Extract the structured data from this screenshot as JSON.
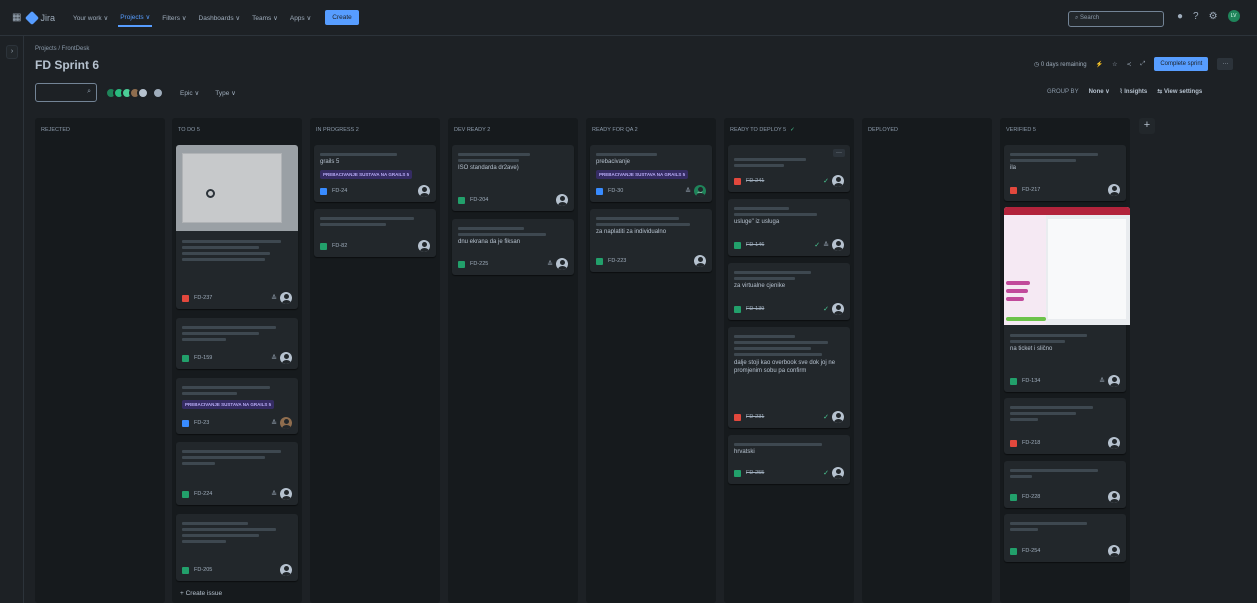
{
  "topnav": {
    "product": "Jira",
    "items": [
      "Your work ∨",
      "Projects ∨",
      "Filters ∨",
      "Dashboards ∨",
      "Teams ∨",
      "Apps ∨"
    ],
    "create": "Create",
    "search_placeholder": "Search",
    "avatar_initials": "LV"
  },
  "header": {
    "breadcrumb": "Projects / FrontDesk",
    "title": "FD Sprint 6",
    "days_remaining": "0 days remaining",
    "complete_sprint": "Complete sprint",
    "more": "···"
  },
  "filters": {
    "epic": "Epic ∨",
    "type": "Type ∨",
    "group_by_label": "GROUP BY",
    "group_by_value": "None ∨",
    "insights": "Insights",
    "view_settings": "View settings"
  },
  "columns": [
    {
      "title": "REJECTED"
    },
    {
      "title": "TO DO 5"
    },
    {
      "title": "IN PROGRESS 2"
    },
    {
      "title": "DEV READY 2"
    },
    {
      "title": "READY FOR QA 2"
    },
    {
      "title": "READY TO DEPLOY 5"
    },
    {
      "title": "DEPLOYED"
    },
    {
      "title": "VERIFIED 5"
    }
  ],
  "cards": {
    "todo": [
      {
        "key": "FD-237"
      },
      {
        "key": "FD-159"
      },
      {
        "key": "FD-23",
        "epic": "PREBACIVANJE SUSTAVA NA GRAILS 5"
      },
      {
        "key": "FD-224"
      },
      {
        "key": "FD-205"
      }
    ],
    "inprogress": [
      {
        "key": "FD-24",
        "text": "grails 5",
        "epic": "PREBACIVANJE SUSTAVA NA GRAILS 5"
      },
      {
        "key": "FD-82"
      }
    ],
    "devready": [
      {
        "key": "FD-204",
        "text": "ISO standarda dr2ave)"
      },
      {
        "key": "FD-225",
        "text": "dnu ekrana da je fiksan"
      }
    ],
    "qa": [
      {
        "key": "FD-30",
        "text": "prebacivanje",
        "epic": "PREBACIVANJE SUSTAVA NA GRAILS 5",
        "assignee": "JD"
      },
      {
        "key": "FD-223",
        "text": "za naplatiti za individualno"
      }
    ],
    "deploy": [
      {
        "key": "FD-241"
      },
      {
        "key": "FD-146",
        "text": "usluge\" iz usluga"
      },
      {
        "key": "FD-139",
        "text": "za virtualne cjenike"
      },
      {
        "key": "FD-231",
        "text": "dalje stoji kao overbook sve dok joj ne promjenim sobu pa confirm"
      },
      {
        "key": "FD-255",
        "text": "hrvatski"
      }
    ],
    "verified": [
      {
        "key": "FD-217",
        "text": "ila"
      },
      {
        "key": "FD-134",
        "text": "na ticket i slično"
      },
      {
        "key": "FD-218"
      },
      {
        "key": "FD-228"
      },
      {
        "key": "FD-254"
      }
    ]
  },
  "create_issue": "+ Create issue",
  "colors": {
    "accent": "#579dff",
    "story": "#22a06b",
    "bug": "#e2483d",
    "task": "#388bff",
    "epic_bg": "#352c63"
  }
}
